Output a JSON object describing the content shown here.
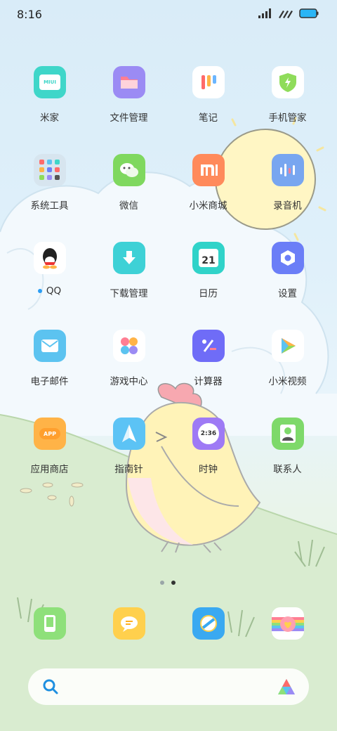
{
  "status_bar": {
    "time": "8:16"
  },
  "rows": [
    [
      {
        "label": "米家",
        "icon": "mijia-icon"
      },
      {
        "label": "文件管理",
        "icon": "folder-icon"
      },
      {
        "label": "笔记",
        "icon": "notes-icon"
      },
      {
        "label": "手机管家",
        "icon": "security-icon"
      }
    ],
    [
      {
        "label": "系统工具",
        "icon": "folder-tools-icon"
      },
      {
        "label": "微信",
        "icon": "wechat-icon"
      },
      {
        "label": "小米商城",
        "icon": "mi-store-icon"
      },
      {
        "label": "录音机",
        "icon": "recorder-icon"
      }
    ],
    [
      {
        "label": "QQ",
        "icon": "qq-icon"
      },
      {
        "label": "下载管理",
        "icon": "download-icon"
      },
      {
        "label": "日历",
        "icon": "calendar-icon"
      },
      {
        "label": "设置",
        "icon": "settings-icon"
      }
    ],
    [
      {
        "label": "电子邮件",
        "icon": "mail-icon"
      },
      {
        "label": "游戏中心",
        "icon": "game-center-icon"
      },
      {
        "label": "计算器",
        "icon": "calculator-icon"
      },
      {
        "label": "小米视频",
        "icon": "video-icon"
      }
    ],
    [
      {
        "label": "应用商店",
        "icon": "app-store-icon"
      },
      {
        "label": "指南针",
        "icon": "compass-icon"
      },
      {
        "label": "时钟",
        "icon": "clock-icon"
      },
      {
        "label": "联系人",
        "icon": "contacts-icon"
      }
    ]
  ],
  "icon_text": {
    "mijia": "MIUI",
    "calendar_day": "21",
    "clock_time": "2:36",
    "app_store": "APP",
    "mi": "mi"
  },
  "dock": [
    {
      "icon": "phone-icon"
    },
    {
      "icon": "messages-icon"
    },
    {
      "icon": "browser-icon"
    },
    {
      "icon": "themes-icon"
    }
  ],
  "pager": {
    "pages": 2,
    "current": 2
  },
  "colors": {
    "accent": "#2a9df4",
    "mijia": "#3fd6c9",
    "files": "#9b8bf4",
    "security": "#8fdc5a",
    "wechat": "#7fd85f",
    "mi": "#ff8a5b",
    "recorder": "#78a6f0",
    "download": "#3ed1d6",
    "calendar": "#30d3c9",
    "settings": "#6b7ef7",
    "mail": "#5cc3f0",
    "calculator": "#6f6cf7",
    "appstore": "#ffb347",
    "compass": "#5cc3f5",
    "clock": "#9e7af5",
    "contacts": "#7ed96a",
    "phone": "#8ee07a",
    "messages": "#ffd04d",
    "browser": "#3aa9f1"
  }
}
